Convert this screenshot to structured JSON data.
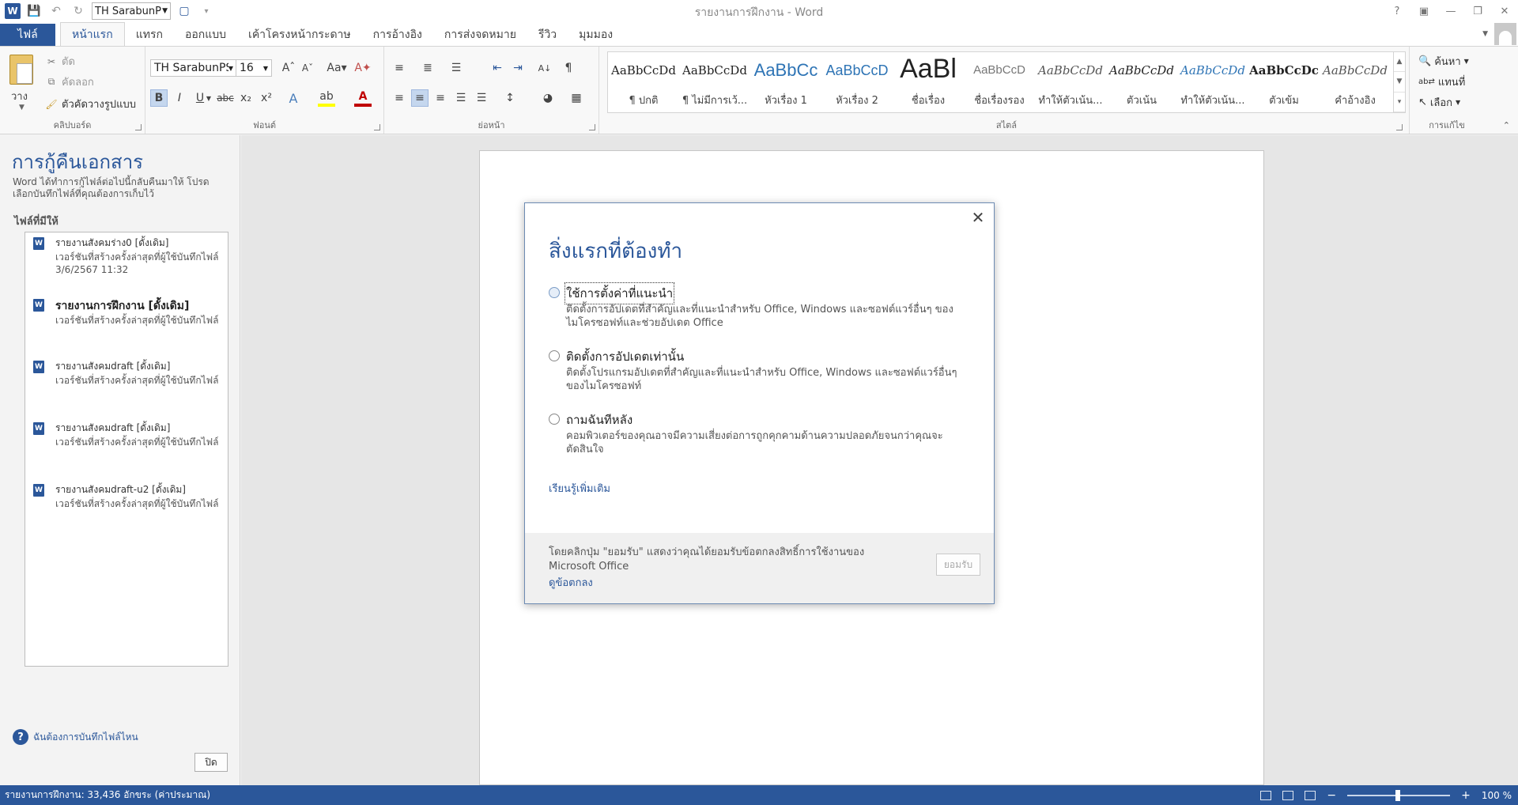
{
  "app": {
    "window_title": "รายงานการฝึกงาน - Word",
    "qat_font": "TH SarabunP"
  },
  "ribbon_tabs": [
    {
      "label": "ไฟล์"
    },
    {
      "label": "หน้าแรก"
    },
    {
      "label": "แทรก"
    },
    {
      "label": "ออกแบบ"
    },
    {
      "label": "เค้าโครงหน้ากระดาษ"
    },
    {
      "label": "การอ้างอิง"
    },
    {
      "label": "การส่งจดหมาย"
    },
    {
      "label": "รีวิว"
    },
    {
      "label": "มุมมอง"
    }
  ],
  "clipboard": {
    "paste": "วาง",
    "cut": "ตัด",
    "copy": "คัดลอก",
    "format_painter": "ตัวคัดวางรูปแบบ",
    "label": "คลิปบอร์ด"
  },
  "font": {
    "name": "TH SarabunPS",
    "size": "16",
    "label": "ฟอนต์"
  },
  "paragraph": {
    "label": "ย่อหน้า"
  },
  "styles": {
    "label": "สไตล์",
    "items": [
      {
        "sample": "AaBbCcDd",
        "name": "¶ ปกติ"
      },
      {
        "sample": "AaBbCcDd",
        "name": "¶ ไม่มีการเว้..."
      },
      {
        "sample": "AaBbCc",
        "name": "หัวเรื่อง 1"
      },
      {
        "sample": "AaBbCcD",
        "name": "หัวเรื่อง 2"
      },
      {
        "sample": "AaBl",
        "name": "ชื่อเรื่อง"
      },
      {
        "sample": "AaBbCcD",
        "name": "ชื่อเรื่องรอง"
      },
      {
        "sample": "AaBbCcDd",
        "name": "ทำให้ตัวเน้น..."
      },
      {
        "sample": "AaBbCcDd",
        "name": "ตัวเน้น"
      },
      {
        "sample": "AaBbCcDd",
        "name": "ทำให้ตัวเน้น..."
      },
      {
        "sample": "AaBbCcDc",
        "name": "ตัวเข้ม"
      },
      {
        "sample": "AaBbCcDd",
        "name": "คำอ้างอิง"
      }
    ]
  },
  "editing": {
    "find": "ค้นหา",
    "replace": "แทนที่",
    "select": "เลือก",
    "label": "การแก้ไข"
  },
  "recovery": {
    "title": "การกู้คืนเอกสาร",
    "description": "Word ได้ทำการกู้ไฟล์ต่อไปนี้กลับคืนมาให้ โปรดเลือกบันทึกไฟล์ที่คุณต้องการเก็บไว้",
    "available_label": "ไฟล์ที่มีให้",
    "files": [
      {
        "name": "รายงานสังคมร่าง0  [ดั้งเดิม]",
        "line1": "เวอร์ชันที่สร้างครั้งล่าสุดที่ผู้ใช้บันทึกไฟล์",
        "line2": "3/6/2567 11:32"
      },
      {
        "name": "รายงานการฝึกงาน  [ดั้งเดิม]",
        "line1": "เวอร์ชันที่สร้างครั้งล่าสุดที่ผู้ใช้บันทึกไฟล์",
        "line2": ""
      },
      {
        "name": "รายงานสังคมdraft  [ดั้งเดิม]",
        "line1": "เวอร์ชันที่สร้างครั้งล่าสุดที่ผู้ใช้บันทึกไฟล์",
        "line2": ""
      },
      {
        "name": "รายงานสังคมdraft  [ดั้งเดิม]",
        "line1": "เวอร์ชันที่สร้างครั้งล่าสุดที่ผู้ใช้บันทึกไฟล์",
        "line2": ""
      },
      {
        "name": "รายงานสังคมdraft-u2  [ดั้งเดิม]",
        "line1": "เวอร์ชันที่สร้างครั้งล่าสุดที่ผู้ใช้บันทึกไฟล์",
        "line2": ""
      }
    ],
    "help_link": "ฉันต้องการบันทึกไฟล์ไหน",
    "close": "ปิด"
  },
  "dialog": {
    "title": "สิ่งแรกที่ต้องทำ",
    "options": [
      {
        "title": "ใช้การตั้งค่าที่แนะนำ",
        "desc": "ติดตั้งการอัปเดตที่สำคัญและที่แนะนำสำหรับ Office, Windows และซอฟต์แวร์อื่นๆ ของไมโครซอฟท์และช่วยอัปเดต Office"
      },
      {
        "title": "ติดตั้งการอัปเดตเท่านั้น",
        "desc": "ติดตั้งโปรแกรมอัปเดตที่สำคัญและที่แนะนำสำหรับ Office, Windows และซอฟต์แวร์อื่นๆ ของไมโครซอฟท์"
      },
      {
        "title": "ถามฉันทีหลัง",
        "desc": "คอมพิวเตอร์ของคุณอาจมีความเสี่ยงต่อการถูกคุกคามด้านความปลอดภัยจนกว่าคุณจะตัดสินใจ"
      }
    ],
    "learn_more": "เรียนรู้เพิ่มเติม",
    "footer_text": "โดยคลิกปุ่ม \"ยอมรับ\" แสดงว่าคุณได้ยอมรับข้อตกลงสิทธิ์การใช้งานของ Microsoft Office",
    "view_agreement": "ดูข้อตกลง",
    "accept": "ยอมรับ"
  },
  "status": {
    "text": "รายงานการฝึกงาน: 33,436 อักขระ (ค่าประมาณ)",
    "zoom": "100 %"
  }
}
